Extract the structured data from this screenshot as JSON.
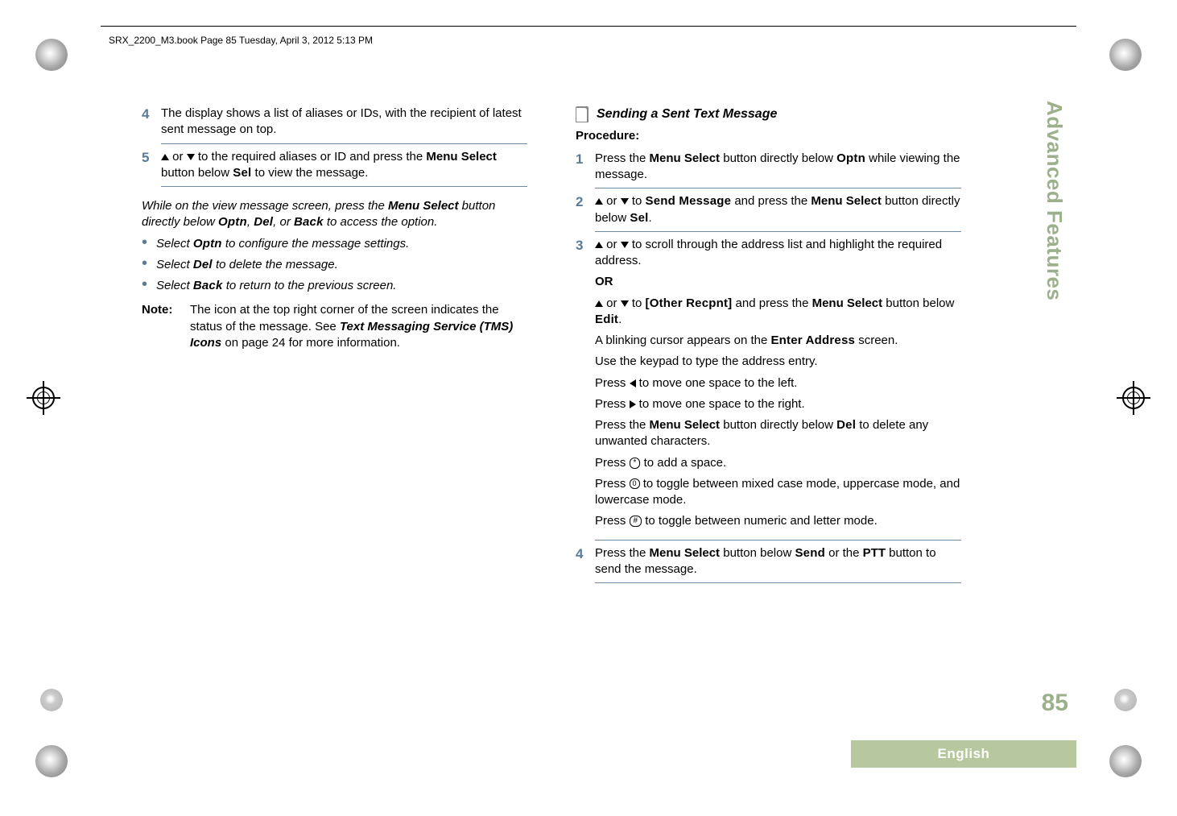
{
  "header": {
    "line": "SRX_2200_M3.book  Page 85  Tuesday, April 3, 2012  5:13 PM"
  },
  "left": {
    "step4": {
      "num": "4",
      "text": "The display shows a list of aliases or IDs, with the recipient of latest sent message on top."
    },
    "step5": {
      "num": "5",
      "pre": " or ",
      "mid1": " to the required aliases or ID and press the ",
      "menu_select": "Menu Select",
      "mid2": " button below ",
      "sel": "Sel",
      "post": " to view the message."
    },
    "view_intro": {
      "a": "While on the view message screen, press the ",
      "ms": "Menu Select",
      "b": " button directly below ",
      "optn": "Optn",
      "c": ", ",
      "del": "Del",
      "d": ", or ",
      "back": "Back",
      "e": " to access the option."
    },
    "bullets": {
      "b1a": "Select ",
      "b1k": "Optn",
      "b1b": " to configure the message settings.",
      "b2a": "Select ",
      "b2k": "Del",
      "b2b": " to delete the message.",
      "b3a": "Select ",
      "b3k": "Back",
      "b3b": " to return to the previous screen."
    },
    "note": {
      "label": "Note:",
      "a": "The icon at the top right corner of the screen indicates the status of the message. See ",
      "ref": "Text Messaging Service (TMS) Icons",
      "b": " on page 24 for more information."
    }
  },
  "right": {
    "heading": "Sending a Sent Text Message",
    "procedure": "Procedure:",
    "s1": {
      "num": "1",
      "a": "Press the ",
      "ms": "Menu Select",
      "b": " button directly below ",
      "optn": "Optn",
      "c": " while viewing the message."
    },
    "s2": {
      "num": "2",
      "or": " or ",
      "to": " to ",
      "sendmsg": "Send Message",
      "and": " and press the ",
      "ms": "Menu Select",
      "below": " button directly below ",
      "sel": "Sel",
      "dot": "."
    },
    "s3": {
      "num": "3",
      "line1a": " or ",
      "line1b": " to scroll through the address list and highlight the required address.",
      "or": "OR",
      "line2a": " or ",
      "line2b": " to ",
      "other": "[Other Recpnt]",
      "line2c": " and press the ",
      "ms": "Menu Select",
      "line2d": " button below ",
      "edit": "Edit",
      "line2e": ".",
      "line3a": "A blinking cursor appears on the ",
      "enter": "Enter Address",
      "line3b": " screen.",
      "line4": "Use the keypad to type the address entry.",
      "line5a": "Press ",
      "line5b": " to move one space to the left.",
      "line6a": "Press ",
      "line6b": " to move one space to the right.",
      "line7a": "Press the ",
      "line7ms": "Menu Select",
      "line7b": " button directly below ",
      "del": "Del",
      "line7c": " to delete any unwanted characters.",
      "line8a": "Press ",
      "kstar": "*",
      "line8b": " to add a space.",
      "line9a": "Press ",
      "kzero": "0",
      "line9b": " to toggle between mixed case mode, uppercase mode, and lowercase mode.",
      "line10a": "Press ",
      "khash": "#",
      "line10b": " to toggle between numeric and letter mode."
    },
    "s4": {
      "num": "4",
      "a": "Press the ",
      "ms": "Menu Select",
      "b": " button below ",
      "send": "Send",
      "c": " or the ",
      "ptt": "PTT",
      "d": " button to send the message."
    }
  },
  "side": {
    "tab": "Advanced Features",
    "page": "85",
    "lang": "English"
  }
}
